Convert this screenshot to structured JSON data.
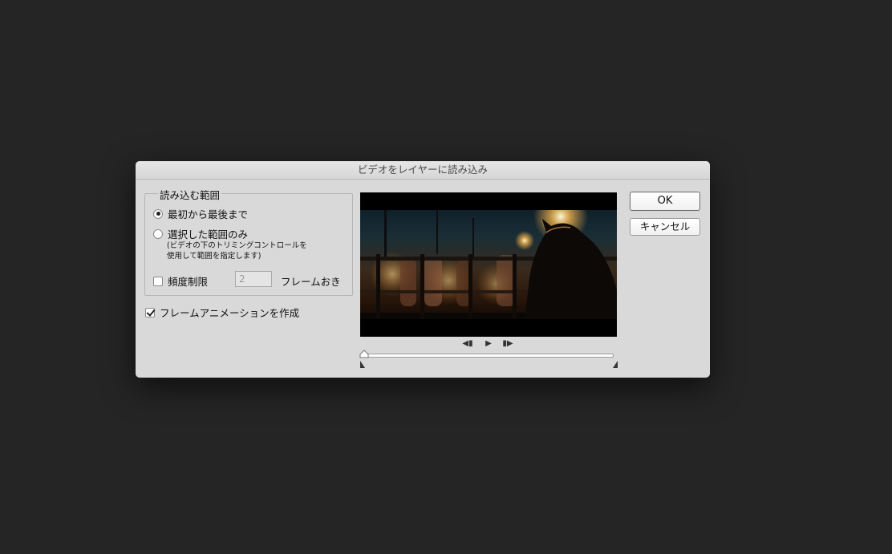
{
  "dialog": {
    "title": "ビデオをレイヤーに読み込み",
    "range_group": {
      "legend": "読み込む範囲",
      "option_all": "最初から最後まで",
      "option_selected": "選択した範囲のみ",
      "note_line1": "(ビデオの下のトリミングコントロールを",
      "note_line2": "使用して範囲を指定します)",
      "selected_option": "最初から最後まで"
    },
    "limit": {
      "label": "頻度制限",
      "checked": false,
      "frames_value": "2",
      "frames_suffix": "フレームおき"
    },
    "animation": {
      "label": "フレームアニメーションを作成",
      "checked": true
    },
    "buttons": {
      "ok": "OK",
      "cancel": "キャンセル"
    },
    "playback": {
      "prev_icon": "step-back-icon",
      "play_icon": "play-icon",
      "next_icon": "step-forward-icon"
    }
  }
}
